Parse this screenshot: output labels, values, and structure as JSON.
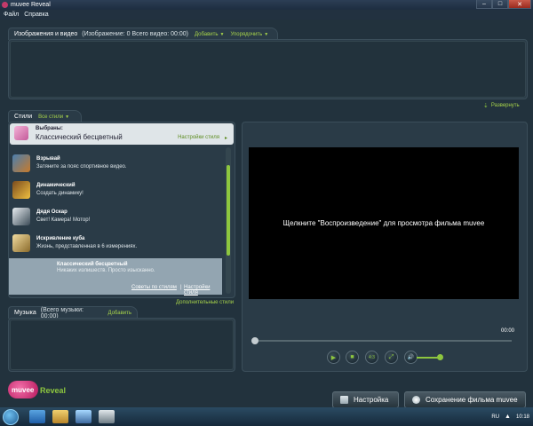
{
  "window": {
    "title": "muvee Reveal",
    "minimize": "–",
    "maximize": "□",
    "close": "✕"
  },
  "menu": {
    "items": [
      "Файл",
      "Справка"
    ]
  },
  "media_panel": {
    "tab_label": "Изображения и видео",
    "counts": "(Изображение: 0   Всего видео: 00:00)",
    "add_label": "Добавить",
    "sort_label": "Упорядочить",
    "expand_label": "Развернуть"
  },
  "styles_panel": {
    "tab_label": "Стили",
    "filter_label": "Все стили",
    "selected_prefix": "Выбраны:",
    "selected_name": "Классический бесцветный",
    "settings_link": "Настройки стиля",
    "items": [
      {
        "name": "Взрывай",
        "desc": "Затяните за пояс спортивное видео.",
        "color": "#c77a2b"
      },
      {
        "name": "Динамический",
        "desc": "Создать динамику!",
        "color": "#e0a030"
      },
      {
        "name": "Дядя Оскар",
        "desc": "Свет! Камера! Мотор!",
        "color": "#6f7f8f"
      },
      {
        "name": "Искривление куба",
        "desc": "Жизнь, представленная в 6 измерениях.",
        "color": "#d9b36a"
      },
      {
        "name": "Классический бесцветный",
        "desc": "Никаких излишеств. Просто изысканно.",
        "color": "#93a5b1"
      }
    ],
    "tips_link": "Советы по стилям",
    "settings_link2": "Настройки стиля",
    "more_styles": "Дополнительные стили"
  },
  "music_panel": {
    "tab_label": "Музыка",
    "counts": "(Всего музыки: 00:00)",
    "add_label": "Добавить"
  },
  "player": {
    "message": "Щелкните \"Воспроизведение\" для просмотра фильма muvee",
    "time": "00:00",
    "play_icon": "▶",
    "stop_icon": "■",
    "ratio_icon": "4:3",
    "fullscreen_icon": "⤢",
    "volume_icon": "🔊"
  },
  "footer": {
    "logo_muvee": "muvee",
    "logo_reveal": "Reveal",
    "settings_button": "Настройка",
    "save_button": "Сохранение фильма muvee"
  },
  "taskbar": {
    "lang": "RU",
    "time": "10:18"
  },
  "colors": {
    "accent": "#8dc63f",
    "link": "#a7d34a",
    "panel": "#2a3b47",
    "video_bg": "#000000"
  }
}
